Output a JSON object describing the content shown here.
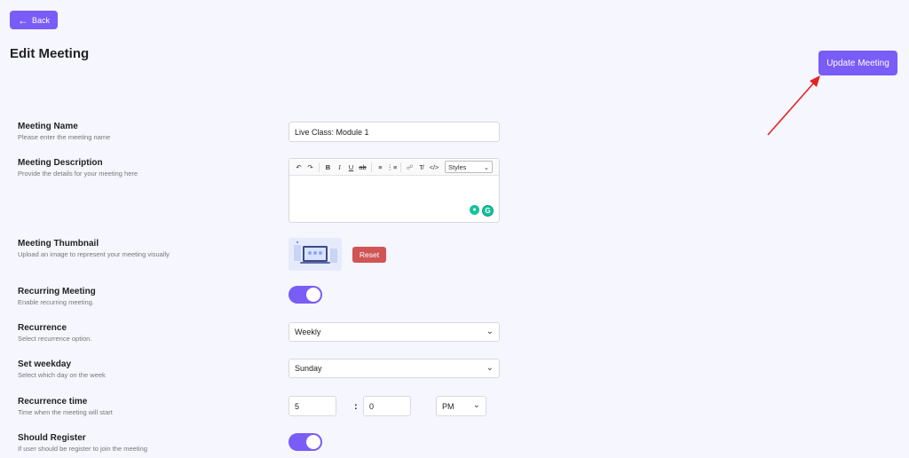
{
  "header": {
    "back_label": "Back",
    "title": "Edit Meeting",
    "update_label": "Update Meeting"
  },
  "fields": {
    "name": {
      "label": "Meeting Name",
      "hint": "Please enter the meeting name",
      "value": "Live Class: Module 1"
    },
    "description": {
      "label": "Meeting Description",
      "hint": "Provide the details for your meeting here",
      "value": "",
      "styles_label": "Styles"
    },
    "thumbnail": {
      "label": "Meeting Thumbnail",
      "hint": "Upload an image to represent your meeting visually",
      "reset_label": "Reset"
    },
    "recurring": {
      "label": "Recurring Meeting",
      "hint": "Enable recurring meeting.",
      "enabled": true
    },
    "recurrence": {
      "label": "Recurrence",
      "hint": "Select recurrence option.",
      "value": "Weekly"
    },
    "weekday": {
      "label": "Set weekday",
      "hint": "Select which day on the week",
      "value": "Sunday"
    },
    "time": {
      "label": "Recurrence time",
      "hint": "Time when the meeting will start",
      "hour": "5",
      "minute": "0",
      "separator": ":",
      "ampm": "PM"
    },
    "register": {
      "label": "Should Register",
      "hint": "If user should be register to join the meeting",
      "enabled": true
    }
  },
  "colors": {
    "accent": "#7a5cf6",
    "danger": "#d05555",
    "annotation": "#e52222",
    "background": "#f5f6fe"
  }
}
